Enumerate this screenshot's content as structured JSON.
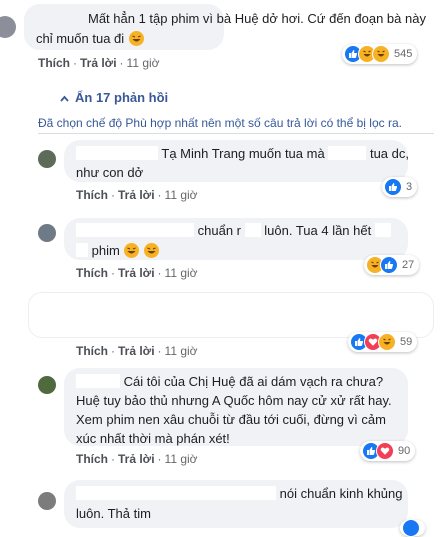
{
  "comments": [
    {
      "text": "Mất hẳn 1 tập phim vì bà Huệ dở hơi. Cứ đến đoạn bà này chỉ muốn tua đi",
      "actions": {
        "like": "Thích",
        "reply": "Trả lời",
        "time": "11 giờ"
      },
      "reactions": {
        "icons": [
          "like-icon",
          "haha-icon",
          "haha-icon"
        ],
        "count": "545"
      }
    }
  ],
  "replies_toggle": "Ẩn 17 phản hồi",
  "filter_notice": "Đã chọn chế độ Phù hợp nhất nên một số câu trả lời có thể bị lọc ra.",
  "replies": [
    {
      "line1": "Tạ Minh Trang muốn tua mà",
      "line1b": "tua dc,",
      "line2": "như con dở",
      "actions": {
        "like": "Thích",
        "reply": "Trả lời",
        "time": "11 giờ"
      },
      "reactions": {
        "count": "3"
      }
    },
    {
      "line1": "chuẩn r",
      "line1b": "luôn. Tua 4 lần hết",
      "line2": "phim",
      "actions": {
        "like": "Thích",
        "reply": "Trả lời",
        "time": "11 giờ"
      },
      "reactions": {
        "count": "27"
      }
    },
    {
      "actions": {
        "like": "Thích",
        "reply": "Trả lời",
        "time": "11 giờ"
      },
      "reactions": {
        "count": "59"
      }
    },
    {
      "text": "Cái tôi của Chị Huệ đã ai dám vạch ra chưa? Huệ tuy bảo thủ nhưng A Quốc hôm nay cử xử rất hay. Xem phim nen xâu chuỗi từ đầu tới cuối, đừng vì cảm xúc nhất thời mà phán xét!",
      "actions": {
        "like": "Thích",
        "reply": "Trả lời",
        "time": "11 giờ"
      },
      "reactions": {
        "count": "90"
      }
    },
    {
      "line1": "nói chuẩn kinh khủng",
      "line2": "luôn. Thả tim"
    }
  ],
  "colors": {
    "bubble": "#f0f2f5",
    "link": "#385898",
    "like": "#1877f2",
    "haha": "#f7b125",
    "love": "#f33e58"
  }
}
